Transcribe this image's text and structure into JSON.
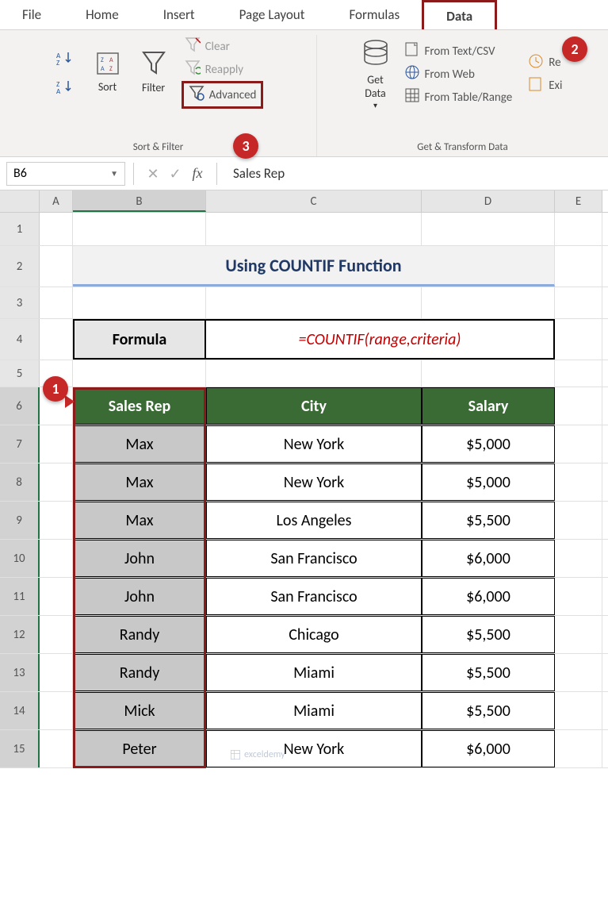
{
  "ribbon": {
    "tabs": [
      "File",
      "Home",
      "Insert",
      "Page Layout",
      "Formulas",
      "Data"
    ],
    "active_tab": "Data",
    "sort_label": "Sort",
    "filter_label": "Filter",
    "clear_label": "Clear",
    "reapply_label": "Reapply",
    "advanced_label": "Advanced",
    "group1_label": "Sort & Filter",
    "getdata_label": "Get\nData",
    "from_csv": "From Text/CSV",
    "from_web": "From Web",
    "from_table": "From Table/Range",
    "recent": "Re",
    "existing": "Exi",
    "group2_label": "Get & Transform Data"
  },
  "formula_bar": {
    "namebox": "B6",
    "formula": "Sales Rep",
    "fx": "fx"
  },
  "callouts": {
    "one": "1",
    "two": "2",
    "three": "3"
  },
  "sheet": {
    "cols": [
      "A",
      "B",
      "C",
      "D",
      "E"
    ],
    "rows": [
      "1",
      "2",
      "3",
      "4",
      "5",
      "6",
      "7",
      "8",
      "9",
      "10",
      "11",
      "12",
      "13",
      "14",
      "15"
    ],
    "title": "Using COUNTIF Function",
    "formula_label": "Formula",
    "formula_value": "=COUNTIF(range,criteria)",
    "headers": [
      "Sales Rep",
      "City",
      "Salary"
    ],
    "data": [
      {
        "rep": "Max",
        "city": "New York",
        "sal": "$5,000"
      },
      {
        "rep": "Max",
        "city": "New York",
        "sal": "$5,000"
      },
      {
        "rep": "Max",
        "city": "Los Angeles",
        "sal": "$5,500"
      },
      {
        "rep": "John",
        "city": "San Francisco",
        "sal": "$6,000"
      },
      {
        "rep": "John",
        "city": "San Francisco",
        "sal": "$6,000"
      },
      {
        "rep": "Randy",
        "city": "Chicago",
        "sal": "$5,500"
      },
      {
        "rep": "Randy",
        "city": "Miami",
        "sal": "$5,500"
      },
      {
        "rep": "Mick",
        "city": "Miami",
        "sal": "$5,500"
      },
      {
        "rep": "Peter",
        "city": "New York",
        "sal": "$6,000"
      }
    ]
  },
  "watermark": "exceldemy"
}
